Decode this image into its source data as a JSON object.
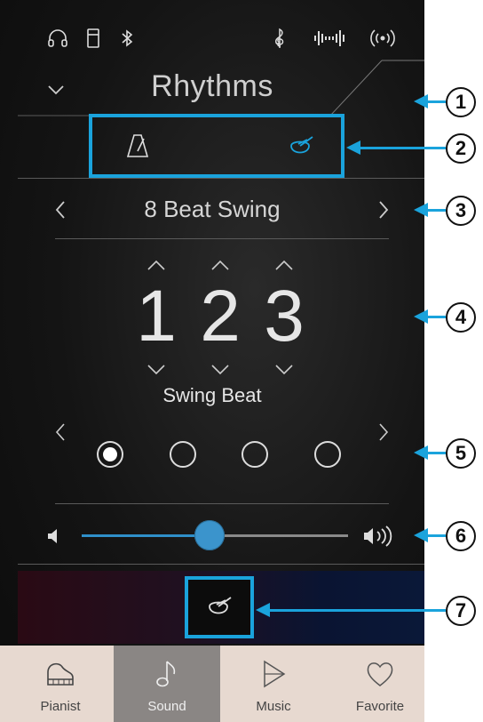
{
  "status_icons": [
    "headphones-icon",
    "usb-drive-icon",
    "bluetooth-icon",
    "treble-clef-icon",
    "sound-wave-icon",
    "wireless-icon"
  ],
  "header": {
    "title": "Rhythms"
  },
  "mode": {
    "metronome_icon": "metronome-icon",
    "drum_icon": "drum-icon"
  },
  "rhythm": {
    "name": "8 Beat Swing"
  },
  "beat": {
    "digits": [
      "1",
      "2",
      "3"
    ],
    "label": "Swing Beat"
  },
  "variation": {
    "options": 4,
    "selected_index": 0
  },
  "volume": {
    "level_fraction": 0.48
  },
  "accent_color": "#1aa3dc",
  "bottom_nav": {
    "items": [
      {
        "label": "Pianist",
        "icon": "piano-icon"
      },
      {
        "label": "Sound",
        "icon": "music-note-icon"
      },
      {
        "label": "Music",
        "icon": "play-icon"
      },
      {
        "label": "Favorite",
        "icon": "heart-icon"
      }
    ],
    "active": "Sound"
  },
  "callouts": [
    "1",
    "2",
    "3",
    "4",
    "5",
    "6",
    "7"
  ]
}
